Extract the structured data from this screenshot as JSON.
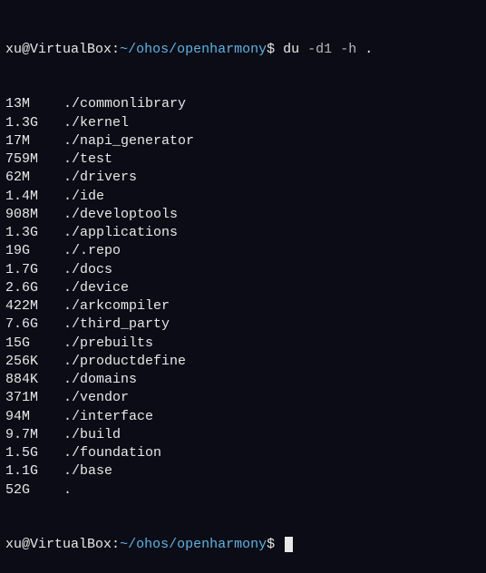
{
  "prompt": {
    "user": "xu",
    "at": "@",
    "host": "VirtualBox",
    "colon": ":",
    "path": "~/ohos/openharmony",
    "dollar": "$",
    "command": "du",
    "flag1": "-d1",
    "flag2": "-h",
    "arg": "."
  },
  "output": [
    {
      "size": "13M",
      "dir": "./commonlibrary"
    },
    {
      "size": "1.3G",
      "dir": "./kernel"
    },
    {
      "size": "17M",
      "dir": "./napi_generator"
    },
    {
      "size": "759M",
      "dir": "./test"
    },
    {
      "size": "62M",
      "dir": "./drivers"
    },
    {
      "size": "1.4M",
      "dir": "./ide"
    },
    {
      "size": "908M",
      "dir": "./developtools"
    },
    {
      "size": "1.3G",
      "dir": "./applications"
    },
    {
      "size": "19G",
      "dir": "./.repo"
    },
    {
      "size": "1.7G",
      "dir": "./docs"
    },
    {
      "size": "2.6G",
      "dir": "./device"
    },
    {
      "size": "422M",
      "dir": "./arkcompiler"
    },
    {
      "size": "7.6G",
      "dir": "./third_party"
    },
    {
      "size": "15G",
      "dir": "./prebuilts"
    },
    {
      "size": "256K",
      "dir": "./productdefine"
    },
    {
      "size": "884K",
      "dir": "./domains"
    },
    {
      "size": "371M",
      "dir": "./vendor"
    },
    {
      "size": "94M",
      "dir": "./interface"
    },
    {
      "size": "9.7M",
      "dir": "./build"
    },
    {
      "size": "1.5G",
      "dir": "./foundation"
    },
    {
      "size": "1.1G",
      "dir": "./base"
    },
    {
      "size": "52G",
      "dir": "."
    }
  ]
}
